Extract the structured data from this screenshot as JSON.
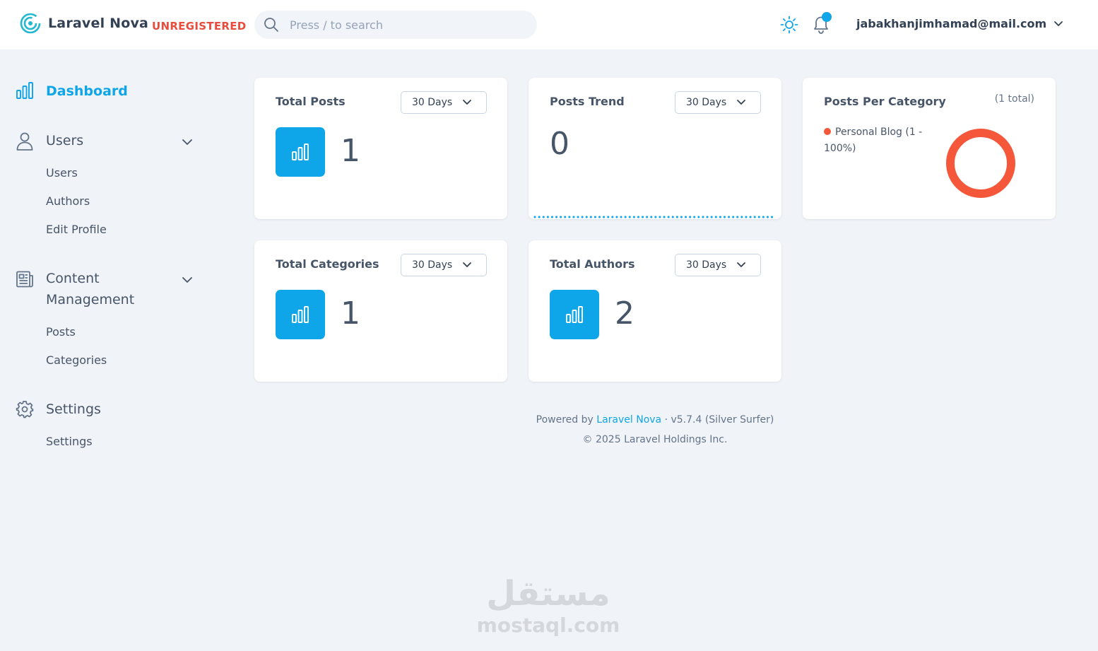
{
  "header": {
    "brand": "Laravel Nova",
    "badge": "UNREGISTERED",
    "search_placeholder": "Press / to search",
    "user_email": "jabakhanjimhamad@mail.com"
  },
  "sidebar": {
    "dashboard": "Dashboard",
    "users": {
      "label": "Users",
      "items": [
        "Users",
        "Authors",
        "Edit Profile"
      ]
    },
    "content": {
      "label_line1": "Content",
      "label_line2": "Management",
      "items": [
        "Posts",
        "Categories"
      ]
    },
    "settings": {
      "label": "Settings",
      "items": [
        "Settings"
      ]
    }
  },
  "cards": {
    "total_posts": {
      "title": "Total Posts",
      "range": "30 Days",
      "value": "1"
    },
    "posts_trend": {
      "title": "Posts Trend",
      "range": "30 Days",
      "value": "0"
    },
    "posts_per_category": {
      "title": "Posts Per Category",
      "total": "(1 total)",
      "legend": [
        {
          "label": "Personal Blog (1 - 100%)",
          "color": "#f5573b"
        }
      ]
    },
    "total_categories": {
      "title": "Total Categories",
      "range": "30 Days",
      "value": "1"
    },
    "total_authors": {
      "title": "Total Authors",
      "range": "30 Days",
      "value": "2"
    }
  },
  "footer": {
    "powered_by": "Powered by",
    "link": "Laravel Nova",
    "version": "· v5.7.4 (Silver Surfer)",
    "copyright": "© 2025 Laravel Holdings Inc."
  },
  "watermark": {
    "arabic": "مستقل",
    "latin": "mostaql.com"
  },
  "colors": {
    "accent": "#0ea5e9",
    "danger": "#e74c3c",
    "pie": "#f5573b",
    "background": "#f0f3f7"
  }
}
